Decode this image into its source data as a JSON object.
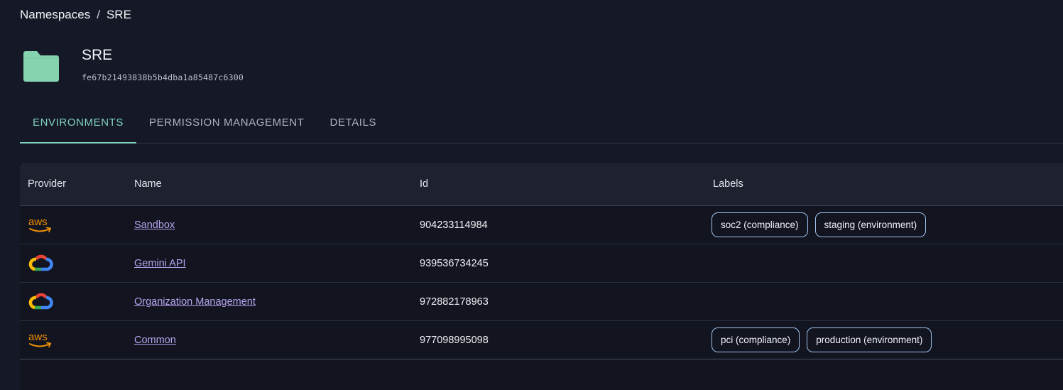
{
  "breadcrumb": {
    "root": "Namespaces",
    "separator": "/",
    "current": "SRE"
  },
  "namespace": {
    "title": "SRE",
    "id": "fe67b21493838b5b4dba1a85487c6300",
    "icon": "folder-icon",
    "icon_color": "#86d3b0"
  },
  "tabs": [
    {
      "label": "ENVIRONMENTS",
      "active": true
    },
    {
      "label": "PERMISSION MANAGEMENT",
      "active": false
    },
    {
      "label": "DETAILS",
      "active": false
    }
  ],
  "table": {
    "columns": {
      "provider": "Provider",
      "name": "Name",
      "id": "Id",
      "labels": "Labels"
    },
    "rows": [
      {
        "provider": "aws",
        "provider_icon": "aws-icon",
        "name": "Sandbox",
        "id": "904233114984",
        "labels": [
          "soc2 (compliance)",
          "staging (environment)"
        ]
      },
      {
        "provider": "gcp",
        "provider_icon": "google-cloud-icon",
        "name": "Gemini API",
        "id": "939536734245",
        "labels": []
      },
      {
        "provider": "gcp",
        "provider_icon": "google-cloud-icon",
        "name": "Organization Management",
        "id": "972882178963",
        "labels": []
      },
      {
        "provider": "aws",
        "provider_icon": "aws-icon",
        "name": "Common",
        "id": "977098995098",
        "labels": [
          "pci (compliance)",
          "production (environment)"
        ]
      }
    ]
  },
  "colors": {
    "background": "#151826",
    "accent": "#7fd1c0",
    "link": "#b5a4f0",
    "chip_border": "#9fc3ee",
    "aws_orange": "#f29100"
  }
}
